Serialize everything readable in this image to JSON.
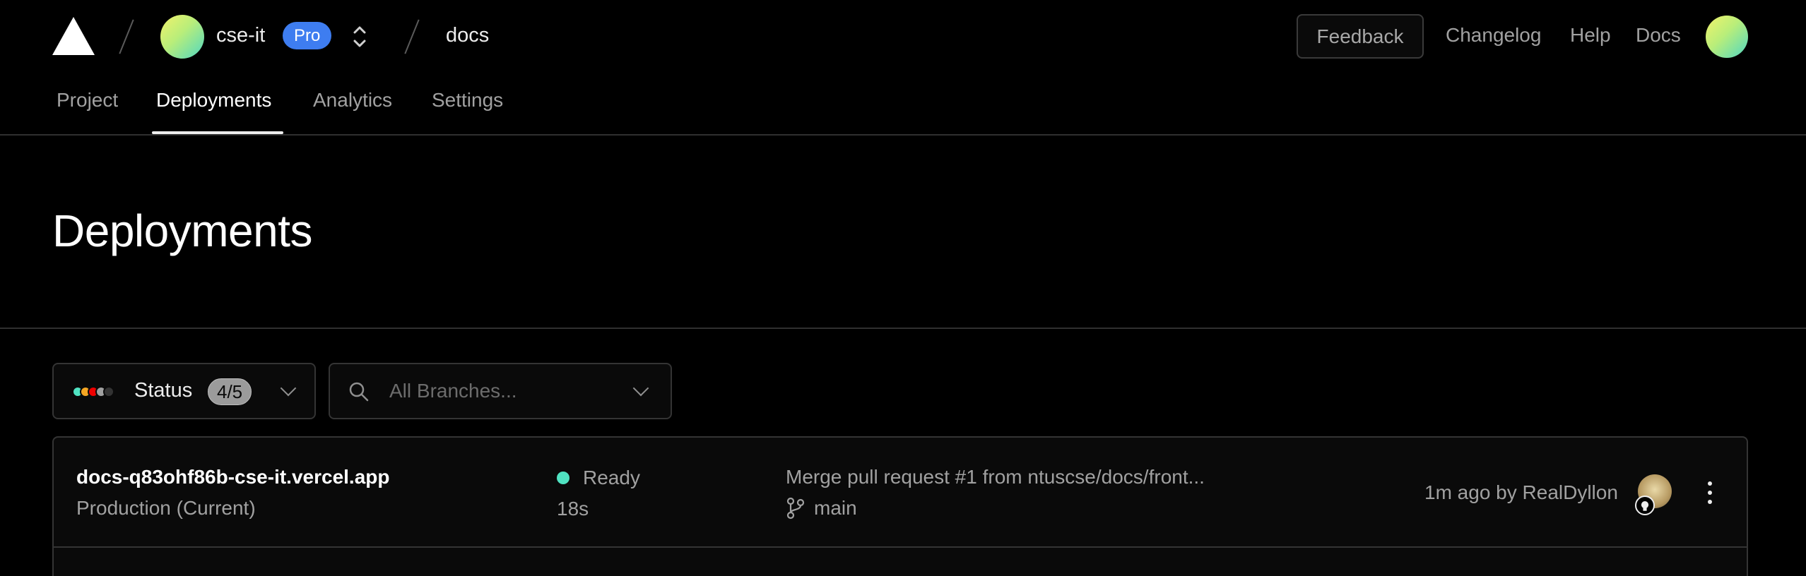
{
  "header": {
    "team": {
      "name": "cse-it",
      "plan_badge": "Pro"
    },
    "project": {
      "name": "docs"
    },
    "feedback_label": "Feedback",
    "links": [
      "Changelog",
      "Help",
      "Docs"
    ]
  },
  "tabs": [
    {
      "label": "Project",
      "active": false
    },
    {
      "label": "Deployments",
      "active": true
    },
    {
      "label": "Analytics",
      "active": false
    },
    {
      "label": "Settings",
      "active": false
    }
  ],
  "page": {
    "title": "Deployments"
  },
  "filters": {
    "status": {
      "label": "Status",
      "count": "4/5",
      "dot_colors": [
        "#50e3c2",
        "#f5a623",
        "#ee0000",
        "#a1a1a1",
        "#333333"
      ]
    },
    "branches": {
      "placeholder": "All Branches..."
    }
  },
  "deployments": [
    {
      "url": "docs-q83ohf86b-cse-it.vercel.app",
      "environment": "Production (Current)",
      "status": "Ready",
      "status_color": "#50e3c2",
      "duration": "18s",
      "commit_message": "Merge pull request #1 from ntuscse/docs/front...",
      "branch": "main",
      "meta": "1m ago by RealDyllon"
    }
  ],
  "icons": [
    "vercel-logo-icon",
    "chevron-up-down-icon",
    "search-icon",
    "chevron-down-icon",
    "git-branch-icon",
    "github-icon",
    "more-vertical-icon"
  ]
}
